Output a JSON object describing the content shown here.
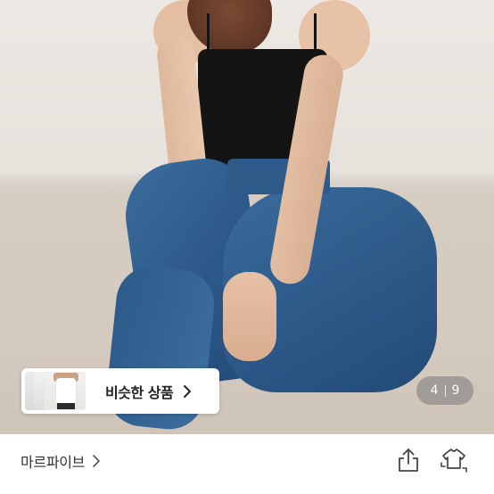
{
  "similar_products": {
    "label": "비슷한 상품",
    "chevron_icon": "chevron-right-icon"
  },
  "image_counter": {
    "current": "4",
    "total": "9"
  },
  "seller": {
    "name": "마르파이브",
    "chevron_icon": "chevron-right-icon"
  },
  "actions": {
    "share_icon": "share-icon",
    "compare_icon": "shirt-swap-icon"
  },
  "colors": {
    "denim": "#2c5888",
    "top": "#141414",
    "background": "#e6e2dc",
    "text_primary": "#222222",
    "counter_bg": "#787878"
  }
}
